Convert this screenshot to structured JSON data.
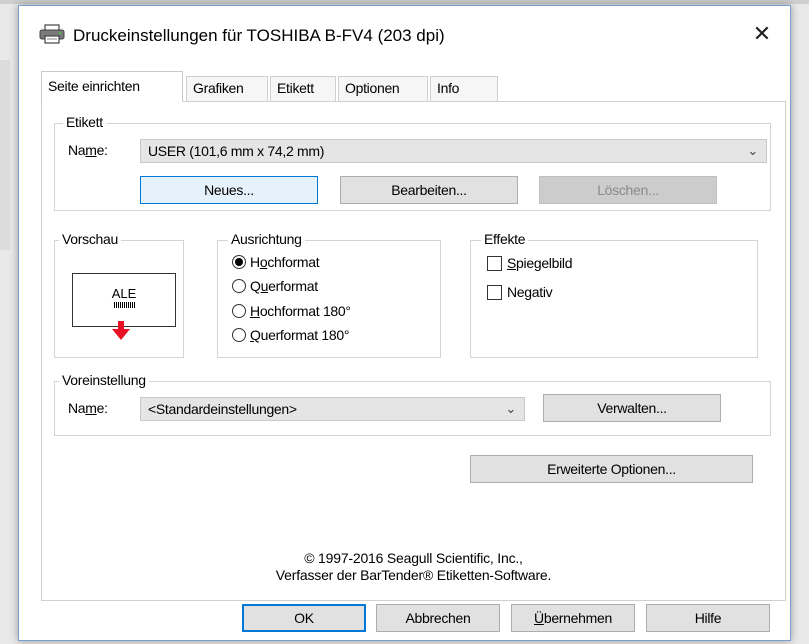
{
  "window": {
    "title": "Druckeinstellungen für TOSHIBA B-FV4 (203 dpi)",
    "close_symbol": "✕",
    "icon": "printer-icon"
  },
  "tabs": [
    {
      "label": "Seite einrichten",
      "active": true
    },
    {
      "label": "Grafiken",
      "active": false
    },
    {
      "label": "Etikett",
      "active": false
    },
    {
      "label": "Optionen",
      "active": false
    },
    {
      "label": "Info",
      "active": false
    }
  ],
  "etikett": {
    "group_label": "Etikett",
    "name_label": "Name:",
    "name_value": "USER (101,6 mm x 74,2 mm)",
    "new_button": "Neues...",
    "edit_button": "Bearbeiten...",
    "delete_button": "Löschen..."
  },
  "vorschau": {
    "group_label": "Vorschau",
    "sample_text": "ALE"
  },
  "ausrichtung": {
    "group_label": "Ausrichtung",
    "options": [
      {
        "label": "Hochformat",
        "selected": true
      },
      {
        "label": "Querformat",
        "selected": false
      },
      {
        "label": "Hochformat 180°",
        "selected": false
      },
      {
        "label": "Querformat 180°",
        "selected": false
      }
    ]
  },
  "effekte": {
    "group_label": "Effekte",
    "options": [
      {
        "label": "Spiegelbild",
        "checked": false
      },
      {
        "label": "Negativ",
        "checked": false
      }
    ]
  },
  "voreinstellung": {
    "group_label": "Voreinstellung",
    "name_label": "Name:",
    "name_value": "<Standardeinstellungen>",
    "manage_button": "Verwalten..."
  },
  "advanced_button": "Erweiterte Optionen...",
  "copyright": {
    "line1": "© 1997-2016 Seagull Scientific, Inc.,",
    "line2": "Verfasser der BarTender® Etiketten-Software."
  },
  "footer": {
    "ok": "OK",
    "cancel": "Abbrechen",
    "apply": "Übernehmen",
    "help": "Hilfe"
  },
  "colors": {
    "focus_blue": "#0078d7",
    "arrow_red": "#e81123"
  }
}
